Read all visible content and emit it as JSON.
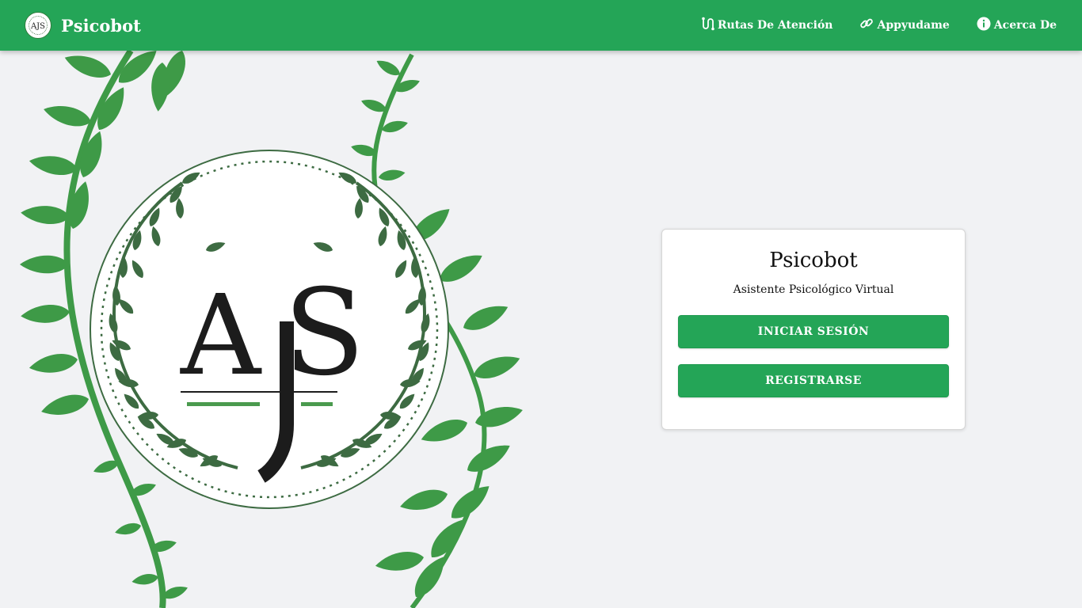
{
  "navbar": {
    "brand": "Psicobot",
    "logo_icon": "aps-seal-logo",
    "links": [
      {
        "label": "Rutas De Atención",
        "icon": "route-icon"
      },
      {
        "label": "Appyudame",
        "icon": "link-icon"
      },
      {
        "label": "Acerca De",
        "icon": "info-icon"
      }
    ]
  },
  "hero": {
    "logo_text": "AJS",
    "logo_icon": "laurel-wreath-emblem"
  },
  "card": {
    "title": "Psicobot",
    "subtitle": "Asistente Psicológico Virtual",
    "login_label": "INICIAR SESIÓN",
    "register_label": "REGISTRARSE"
  },
  "colors": {
    "primary": "#24a557",
    "leaf_green": "#3e9a47",
    "dark_leaf": "#3d6b42",
    "background": "#f1f2f4"
  }
}
